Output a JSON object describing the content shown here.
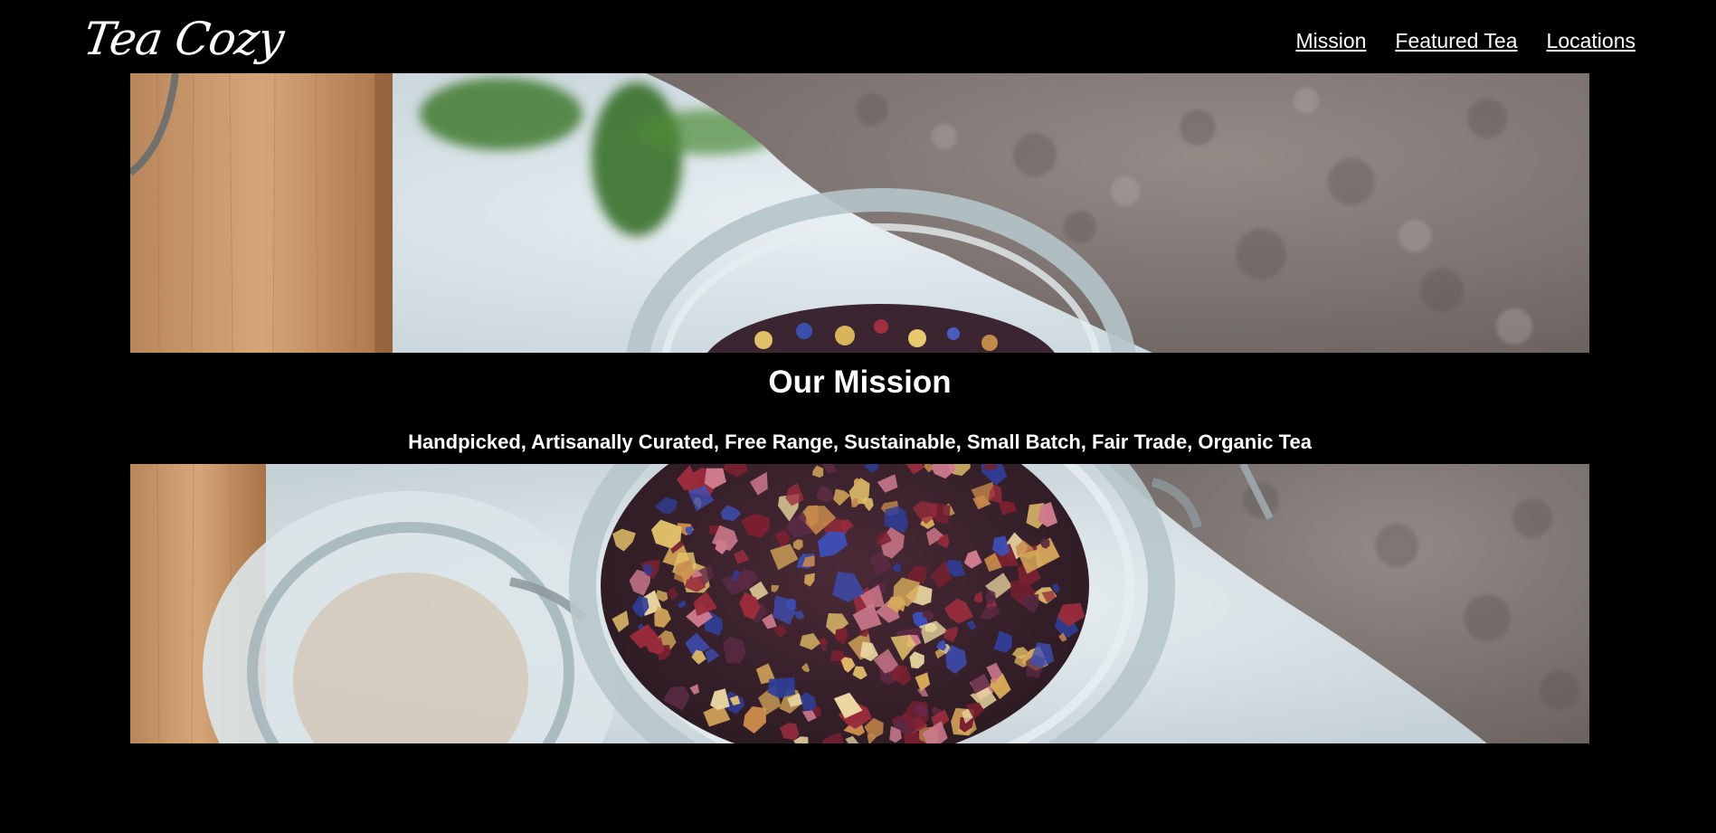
{
  "header": {
    "logo": "Tea Cozy",
    "nav": [
      {
        "label": "Mission"
      },
      {
        "label": "Featured Tea"
      },
      {
        "label": "Locations"
      }
    ]
  },
  "mission": {
    "title": "Our Mission",
    "subtitle": "Handpicked, Artisanally Curated, Free Range, Sustainable, Small Batch, Fair Trade, Organic Tea"
  },
  "colors": {
    "background": "#000000",
    "text": "#ffffff"
  }
}
